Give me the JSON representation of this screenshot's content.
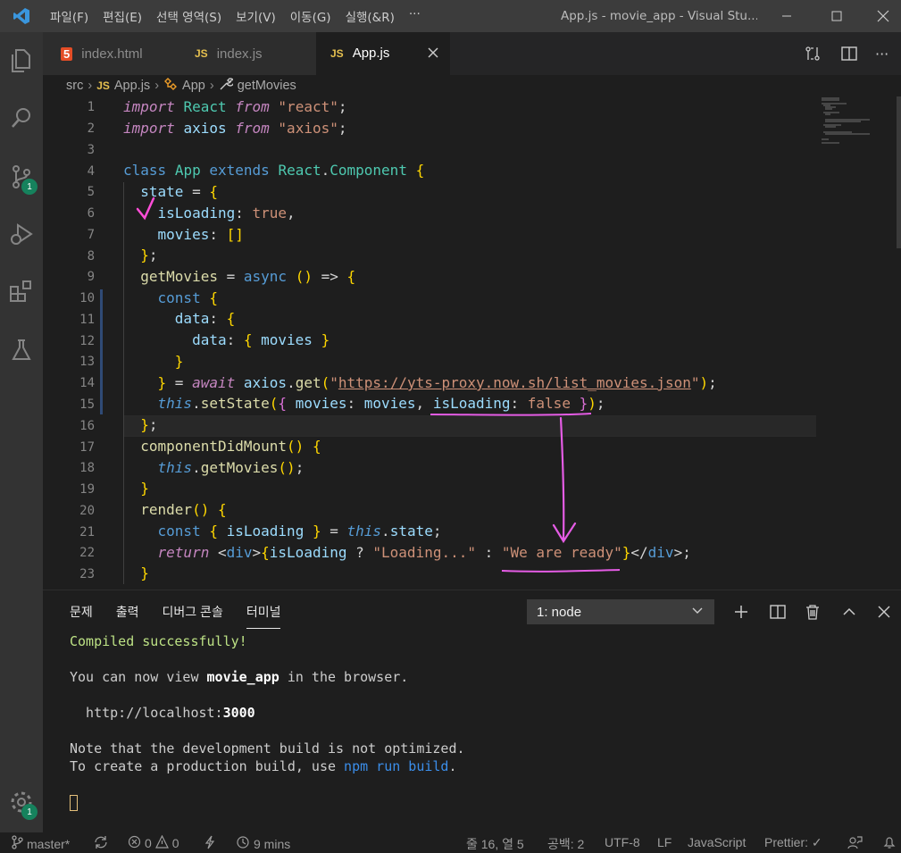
{
  "titlebar": {
    "menu": [
      "파일(F)",
      "편집(E)",
      "선택 영역(S)",
      "보기(V)",
      "이동(G)",
      "실행(&R)",
      "···"
    ],
    "title": "App.js - movie_app - Visual Stu..."
  },
  "activity": {
    "source_control_badge": "1",
    "settings_badge": "1"
  },
  "tabs": [
    {
      "label": "index.html",
      "icon": "html5-icon",
      "icon_text": "5",
      "active": false
    },
    {
      "label": "index.js",
      "icon": "js-icon",
      "icon_text": "JS",
      "active": false
    },
    {
      "label": "App.js",
      "icon": "js-icon",
      "icon_text": "JS",
      "active": true
    }
  ],
  "breadcrumb": {
    "folder": "src",
    "file_icon": "JS",
    "file": "App.js",
    "class": "App",
    "method": "getMovies"
  },
  "editor": {
    "line_numbers": [
      "1",
      "2",
      "3",
      "4",
      "5",
      "6",
      "7",
      "8",
      "9",
      "10",
      "11",
      "12",
      "13",
      "14",
      "15",
      "16",
      "17",
      "18",
      "19",
      "20",
      "21",
      "22",
      "23"
    ],
    "lines": [
      "import React from \"react\";",
      "import axios from \"axios\";",
      "",
      "class App extends React.Component {",
      "  state = {",
      "    isLoading: true,",
      "    movies: []",
      "  };",
      "  getMovies = async () => {",
      "    const {",
      "      data: {",
      "        data: { movies }",
      "      }",
      "    } = await axios.get(\"https://yts-proxy.now.sh/list_movies.json\");",
      "    this.setState({ movies: movies, isLoading: false });",
      "  };",
      "  componentDidMount() {",
      "    this.getMovies();",
      "  }",
      "  render() {",
      "    const { isLoading } = this.state;",
      "    return <div>{isLoading ? \"Loading...\" : \"We are ready\"}</div>;",
      "  }"
    ],
    "annotations": {
      "checkmark_color": "#ff4dd8",
      "underline_color": "#e55ce5",
      "arrow_color": "#e55ce5"
    }
  },
  "panel": {
    "tabs": [
      "문제",
      "출력",
      "디버그 콘솔",
      "터미널"
    ],
    "active_tab": "터미널",
    "terminal_select": "1: node",
    "terminal": {
      "compiled": "Compiled successfully!",
      "view_prefix": "You can now view ",
      "app_name": "movie_app",
      "view_suffix": " in the browser.",
      "url_prefix": "  http://localhost:",
      "port": "3000",
      "note1": "Note that the development build is not optimized.",
      "note2_prefix": "To create a production build, use ",
      "note2_cmd": "npm run build",
      "note2_suffix": "."
    }
  },
  "statusbar": {
    "branch": "master*",
    "errors": "0",
    "warnings": "0",
    "time": "9 mins",
    "position": "줄 16, 열 5",
    "spaces": "공백: 2",
    "encoding": "UTF-8",
    "eol": "LF",
    "language": "JavaScript",
    "prettier": "Prettier: ✓"
  }
}
